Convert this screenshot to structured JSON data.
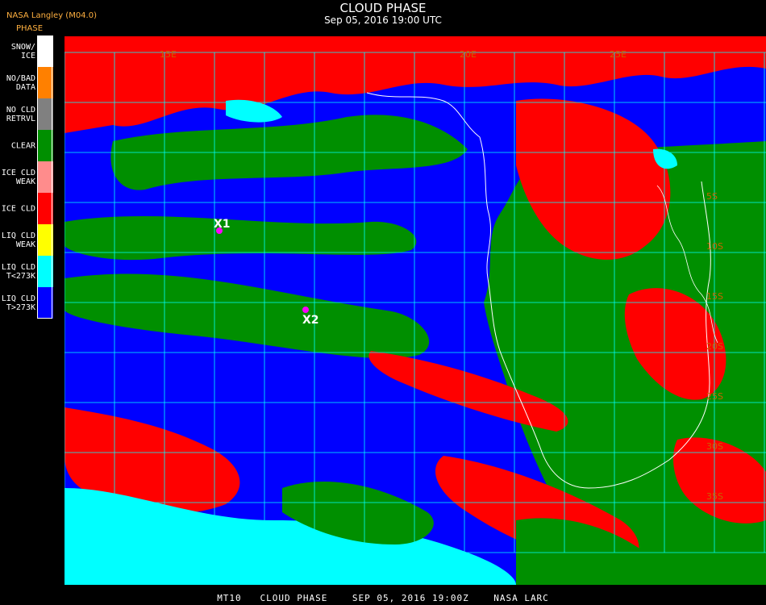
{
  "header": {
    "source": "NASA Langley (M04.0)",
    "legend_title": "PHASE",
    "title": "CLOUD PHASE",
    "datetime": "Sep 05, 2016 19:00 UTC"
  },
  "legend": [
    {
      "label": "SNOW/\nICE",
      "color": "#ffffff"
    },
    {
      "label": "NO/BAD\nDATA",
      "color": "#ff8000"
    },
    {
      "label": "NO CLD\nRETRVL",
      "color": "#808080"
    },
    {
      "label": "CLEAR",
      "color": "#008f00"
    },
    {
      "label": "ICE CLD\nWEAK",
      "color": "#ff8c8c"
    },
    {
      "label": "ICE CLD",
      "color": "#ff0000"
    },
    {
      "label": "LIQ CLD\nWEAK",
      "color": "#ffff00"
    },
    {
      "label": "LIQ CLD\nT<273K",
      "color": "#00ffff"
    },
    {
      "label": "LIQ CLD\nT>273K",
      "color": "#0000ff"
    }
  ],
  "map": {
    "grid_color": "#00ffff",
    "coastline_color": "#ffffff",
    "lat_labels": [
      "5S",
      "10S",
      "15S",
      "20S",
      "25S",
      "30S",
      "35S"
    ],
    "lon_labels": [
      "15E",
      "20E",
      "25E"
    ],
    "markers": [
      {
        "label": "X1",
        "color": "#ff00ff"
      },
      {
        "label": "X2",
        "color": "#ff00ff"
      }
    ]
  },
  "footer": "MT10   CLOUD PHASE    SEP 05, 2016 19:00Z    NASA LARC"
}
